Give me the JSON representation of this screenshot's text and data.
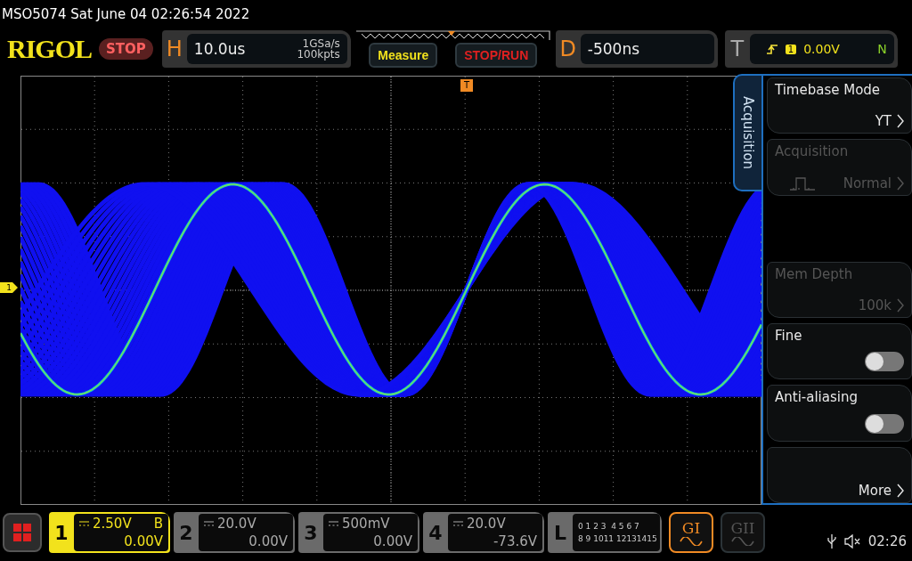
{
  "title": "MSO5074  Sat June 04 02:26:54 2022",
  "logo": "RIGOL",
  "run_state": "STOP",
  "horizontal": {
    "letter": "H",
    "scale": "10.0us",
    "sample_rate": "1GSa/s",
    "memory": "100kpts"
  },
  "buttons": [
    {
      "label": "Measure",
      "kind": "measure"
    },
    {
      "label": "STOP/RUN",
      "kind": "stoprun"
    }
  ],
  "delay": {
    "letter": "D",
    "value": "-500ns"
  },
  "trigger": {
    "letter": "T",
    "source": "1",
    "level": "0.00V",
    "mode": "N"
  },
  "trigger_marker": "T",
  "channel_marker": "1",
  "menu": {
    "tab": "Acquisition",
    "items": [
      {
        "kind": "select",
        "label": "Timebase Mode",
        "value": "YT",
        "disabled": false
      },
      {
        "kind": "select",
        "label": "Acquisition",
        "value": "Normal",
        "disabled": true
      },
      {
        "kind": "select",
        "label": "Mem Depth",
        "value": "100k",
        "disabled": true
      },
      {
        "kind": "toggle",
        "label": "Fine",
        "on": false
      },
      {
        "kind": "toggle",
        "label": "Anti-aliasing",
        "on": false
      },
      {
        "kind": "select",
        "value": "More",
        "disabled": false
      }
    ]
  },
  "channels": [
    {
      "number": "1",
      "scale": "2.50V",
      "offset": "0.00V",
      "flag": "B",
      "on": true
    },
    {
      "number": "2",
      "scale": "20.0V",
      "offset": "0.00V",
      "on": false
    },
    {
      "number": "3",
      "scale": "500mV",
      "offset": "0.00V",
      "on": false
    },
    {
      "number": "4",
      "scale": "20.0V",
      "offset": "-73.6V",
      "on": false
    }
  ],
  "logic": {
    "letter": "L",
    "rows": [
      "0 1 2 3  4 5 6 7",
      "8 9 1011 12131415"
    ]
  },
  "generators": [
    {
      "label": "GI",
      "on": true
    },
    {
      "label": "GII",
      "on": false
    }
  ],
  "status": {
    "time": "02:26"
  }
}
